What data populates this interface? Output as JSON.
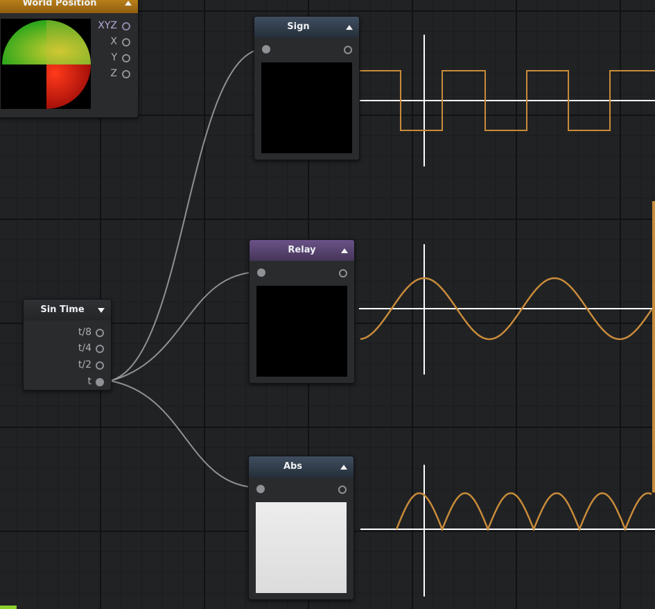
{
  "nodes": {
    "world_position": {
      "title": "World Position",
      "outputs": [
        "XYZ",
        "X",
        "Y",
        "Z"
      ]
    },
    "sign": {
      "title": "Sign"
    },
    "relay": {
      "title": "Relay"
    },
    "abs": {
      "title": "Abs"
    },
    "sin_time": {
      "title": "Sin Time",
      "outputs": [
        "t/8",
        "t/4",
        "t/2",
        "t"
      ]
    }
  },
  "colors": {
    "canvas_bg": "#212224",
    "wave": "#c98c3a",
    "axis": "#ffffff",
    "wire": "#a4a5a8",
    "sign_header": "#3a4758",
    "relay_header": "#5e4a7a",
    "abs_header": "#3a4758",
    "world_position_header": "#c78a1c"
  },
  "icons": {
    "collapse": "triangle-up-icon",
    "expand": "triangle-down-icon",
    "port": "circle-port-icon"
  }
}
